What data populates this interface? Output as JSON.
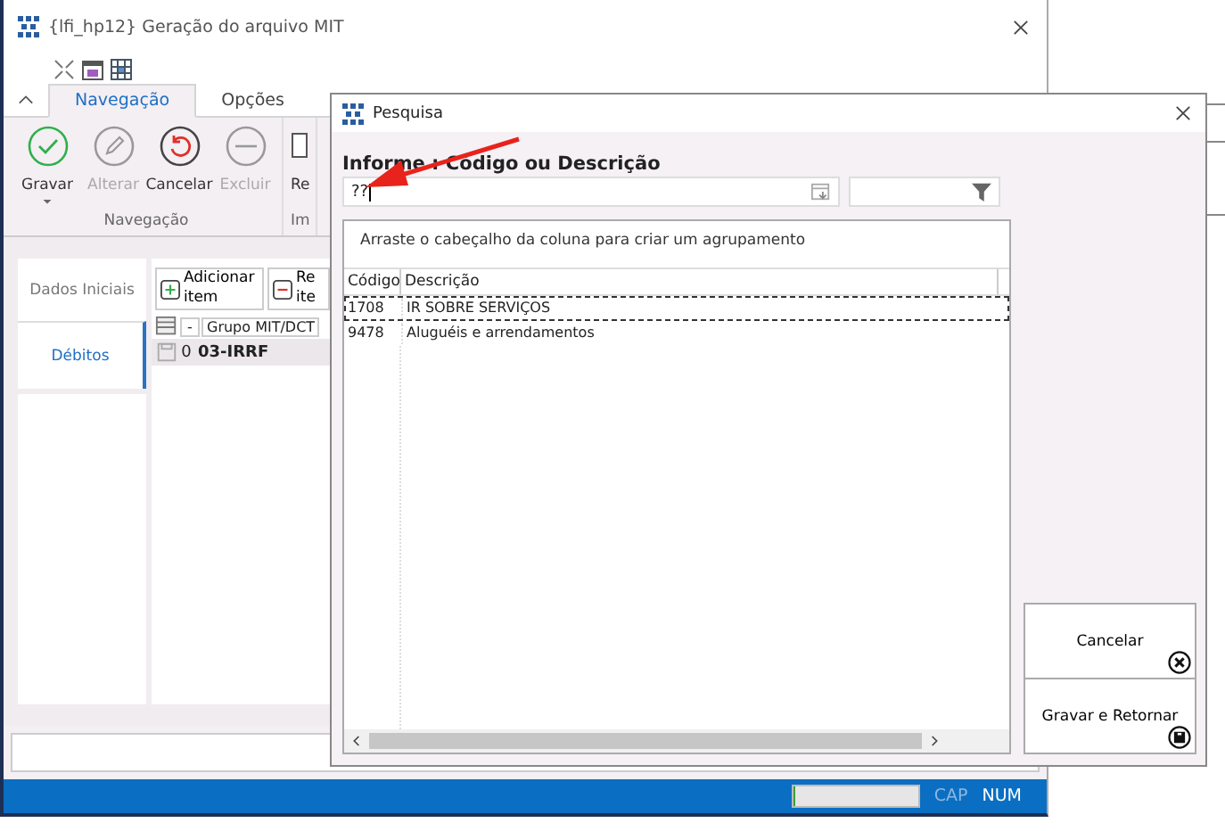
{
  "main_window": {
    "title": "{lfi_hp12}  Geração do arquivo MIT",
    "ribbon_tabs": [
      {
        "label": "Navegação",
        "selected": true
      },
      {
        "label": "Opções",
        "selected": false
      }
    ],
    "ribbon_buttons": [
      {
        "label": "Gravar",
        "kind": "save",
        "disabled": false,
        "dropdown": true
      },
      {
        "label": "Alterar",
        "kind": "edit",
        "disabled": true,
        "dropdown": false
      },
      {
        "label": "Cancelar",
        "kind": "undo",
        "disabled": false,
        "dropdown": false
      },
      {
        "label": "Excluir",
        "kind": "delete",
        "disabled": true,
        "dropdown": false
      },
      {
        "label": "Re",
        "kind": "report",
        "disabled": false,
        "dropdown": false
      }
    ],
    "ribbon_groups": [
      "Navegação",
      "Im"
    ],
    "side_tabs": [
      {
        "label": "Dados Iniciais",
        "selected": false
      },
      {
        "label": "Débitos",
        "selected": true
      }
    ],
    "grid_buttons": [
      {
        "label": "Adicionar item",
        "kind": "add"
      },
      {
        "label": "Re ite",
        "kind": "remove"
      }
    ],
    "grid": {
      "columns": [
        "-",
        "Grupo MIT/DCT"
      ],
      "rows": [
        {
          "index": "0",
          "group": "03-IRRF"
        }
      ]
    },
    "status_bar": {
      "progress": {
        "level": 0.02
      },
      "indicators": [
        {
          "label": "CAP",
          "on": false
        },
        {
          "label": "NUM",
          "on": true
        }
      ]
    }
  },
  "dialog": {
    "title": "Pesquisa",
    "prompt": "Informe : Código ou Descrição",
    "search_value": "??",
    "group_hint": "Arraste o cabeçalho da coluna para criar um agrupamento",
    "columns": [
      "Código",
      "Descrição"
    ],
    "rows": [
      {
        "code": "1708",
        "description": "IR SOBRE SERVIÇOS",
        "selected": true
      },
      {
        "code": "9478",
        "description": "Aluguéis e arrendamentos",
        "selected": false
      }
    ],
    "buttons": [
      {
        "label": "Cancelar",
        "kind": "cancel"
      },
      {
        "label": "Gravar e Retornar",
        "kind": "save"
      }
    ]
  }
}
